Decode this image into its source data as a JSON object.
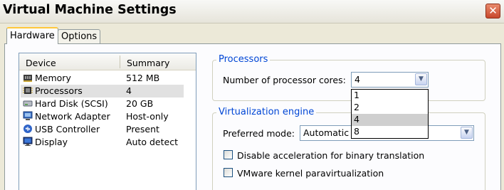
{
  "window": {
    "title": "Virtual Machine Settings",
    "close_glyph": "✕"
  },
  "tabs": [
    {
      "label": "Hardware"
    },
    {
      "label": "Options"
    }
  ],
  "device_list": {
    "columns": {
      "device": "Device",
      "summary": "Summary"
    },
    "rows": [
      {
        "icon": "memory-icon",
        "name": "Memory",
        "summary": "512 MB"
      },
      {
        "icon": "processor-icon",
        "name": "Processors",
        "summary": "4"
      },
      {
        "icon": "hard-disk-icon",
        "name": "Hard Disk (SCSI)",
        "summary": "20 GB"
      },
      {
        "icon": "network-adapter-icon",
        "name": "Network Adapter",
        "summary": "Host-only"
      },
      {
        "icon": "usb-controller-icon",
        "name": "USB Controller",
        "summary": "Present"
      },
      {
        "icon": "display-icon",
        "name": "Display",
        "summary": "Auto detect"
      }
    ],
    "selected": "Processors"
  },
  "processors": {
    "group_title": "Processors",
    "cores_label": "Number of processor cores:",
    "cores_value": "4",
    "dropdown_open": true,
    "cores_options": [
      "1",
      "2",
      "4",
      "8"
    ],
    "highlighted_option": "4"
  },
  "virtualization": {
    "group_title": "Virtualization engine",
    "preferred_mode_label": "Preferred mode:",
    "preferred_mode_value": "Automatic",
    "checkboxes": [
      {
        "label": "Disable acceleration for binary translation",
        "checked": false
      },
      {
        "label": "VMware kernel paravirtualization",
        "checked": false
      }
    ]
  },
  "colors": {
    "group_title": "#0046d5",
    "selected_row": "#e1e1e1",
    "highlighted_option": "#cfcfcf"
  }
}
